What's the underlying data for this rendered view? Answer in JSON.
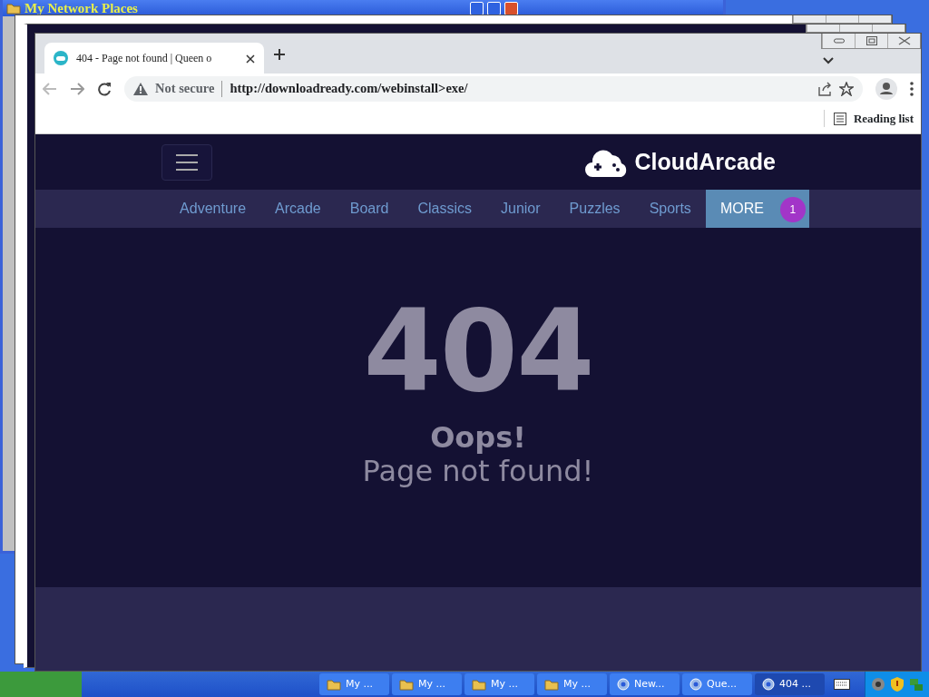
{
  "background_window": {
    "title": "My Network Places"
  },
  "browser": {
    "tab": {
      "title": "404 - Page not found | Queen o"
    },
    "address_bar": {
      "security": "Not secure",
      "url": "http://downloadready.com/webinstall>exe/"
    },
    "bookmarks_bar": {
      "reading_list": "Reading list"
    }
  },
  "site": {
    "logo": "CloudArcade",
    "nav": [
      {
        "label": "Adventure",
        "kind": "link"
      },
      {
        "label": "Arcade",
        "kind": "link"
      },
      {
        "label": "Board",
        "kind": "link"
      },
      {
        "label": "Classics",
        "kind": "link"
      },
      {
        "label": "Junior",
        "kind": "link"
      },
      {
        "label": "Puzzles",
        "kind": "link"
      },
      {
        "label": "Sports",
        "kind": "link"
      },
      {
        "label": "MORE",
        "kind": "more",
        "badge": "1"
      }
    ],
    "error": {
      "code": "404",
      "title": "Oops!",
      "message": "Page not found!"
    }
  },
  "taskbar": {
    "items": [
      {
        "label": "My ...",
        "kind": "folder",
        "selected": false
      },
      {
        "label": "My ...",
        "kind": "folder",
        "selected": false
      },
      {
        "label": "My ...",
        "kind": "folder",
        "selected": false
      },
      {
        "label": "My ...",
        "kind": "folder",
        "selected": false
      },
      {
        "label": "New...",
        "kind": "browser",
        "selected": false
      },
      {
        "label": "Que...",
        "kind": "browser",
        "selected": false
      },
      {
        "label": "404 ...",
        "kind": "browser",
        "selected": true
      }
    ]
  }
}
